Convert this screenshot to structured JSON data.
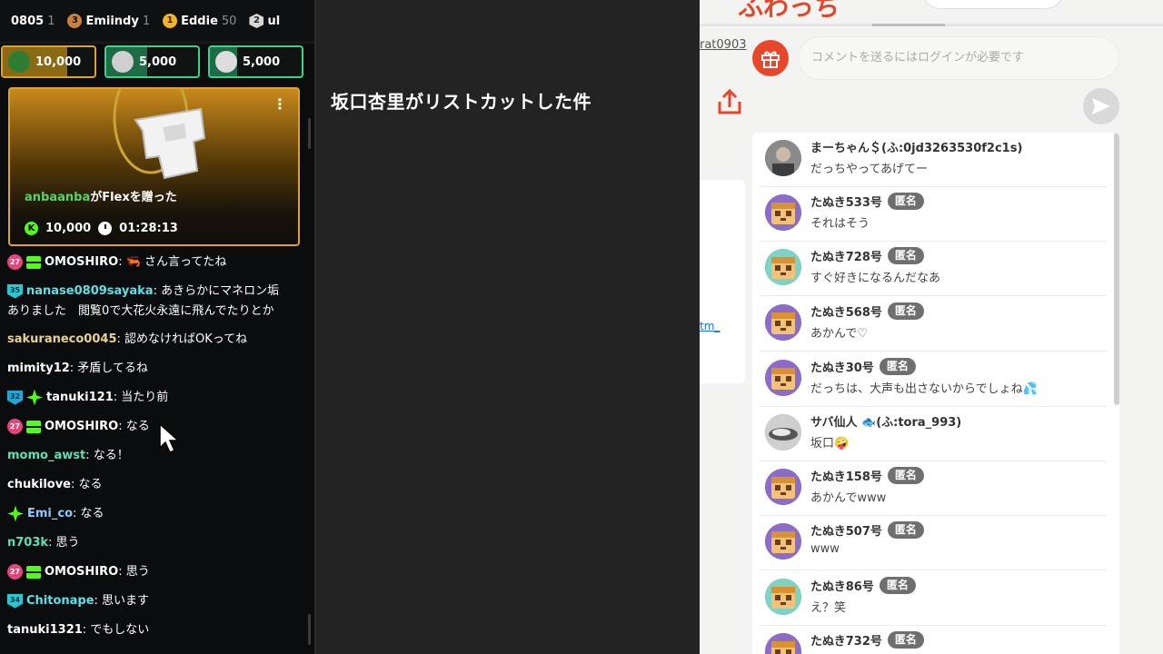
{
  "left_chat": {
    "leaderboard": [
      {
        "name": "0805",
        "count": "1",
        "medal": "none"
      },
      {
        "rank": "3",
        "name": "Emiindy",
        "count": "1",
        "medal": "bronze"
      },
      {
        "rank": "1",
        "name": "Eddie",
        "count": "50",
        "medal": "gold"
      },
      {
        "rank": "2",
        "name": "ul",
        "count": "",
        "medal": "silver"
      }
    ],
    "gift_pills": [
      {
        "amount": "10,000",
        "fill": 0.7,
        "border": "#e0a32a",
        "fill_color": "#8a6a14",
        "avatar": "#2e7d32"
      },
      {
        "amount": "5,000",
        "fill": 0.45,
        "border": "#3ad48a",
        "fill_color": "#1f6b45",
        "avatar": "#cfcfcf"
      },
      {
        "amount": "5,000",
        "fill": 0.3,
        "border": "#3ad48a",
        "fill_color": "#1f6b45",
        "avatar": "#dcdcdc"
      }
    ],
    "gift_card": {
      "user": "anbaanba",
      "text": "がFlexを贈った",
      "amount": "10,000",
      "time": "01:28:13"
    },
    "messages": [
      {
        "badges": [
          "sub27",
          "gift"
        ],
        "name": "OMOSHIRO",
        "color": "#ffffff",
        "text": ": 🦐 さん言ってたね"
      },
      {
        "badges": [
          "sub35"
        ],
        "name": "nanase0809sayaka",
        "color": "#5ce0e8",
        "text": ": あきらかにマネロン垢",
        "text2": "ありました　閲覧0で大花火永遠に飛んでたりとか"
      },
      {
        "badges": [],
        "name": "sakuraneco0045",
        "color": "#e9d28a",
        "text": ": 認めなければOKってね"
      },
      {
        "badges": [],
        "name": "mimity12",
        "color": "#ffffff",
        "text": ": 矛盾してるね"
      },
      {
        "badges": [
          "sub32",
          "star"
        ],
        "name": "tanuki121",
        "color": "#ffffff",
        "text": ": 当たり前"
      },
      {
        "badges": [
          "sub27",
          "gift"
        ],
        "name": "OMOSHIRO",
        "color": "#ffffff",
        "text": ": なる"
      },
      {
        "badges": [],
        "name": "momo_awst",
        "color": "#5ce0b5",
        "text": ": なる！"
      },
      {
        "badges": [],
        "name": "chukilove",
        "color": "#ffffff",
        "text": ": なる"
      },
      {
        "badges": [
          "star"
        ],
        "name": "Emi_co",
        "color": "#8fc7ff",
        "text": ": なる"
      },
      {
        "badges": [],
        "name": "n703k",
        "color": "#5ce0b5",
        "text": ": 思う"
      },
      {
        "badges": [
          "sub27",
          "gift"
        ],
        "name": "OMOSHIRO",
        "color": "#ffffff",
        "text": ": 思う"
      },
      {
        "badges": [
          "sub34"
        ],
        "name": "Chitonape",
        "color": "#5ce0e8",
        "text": ": 思います"
      },
      {
        "badges": [],
        "name": "tanuki1321",
        "color": "#ffffff",
        "text": ": でもしない"
      }
    ]
  },
  "center": {
    "title": "坂口杏里がリストカットした件"
  },
  "right_page": {
    "logo_text": "ふわっち",
    "user_link": "rat0903",
    "comment_placeholder": "コメントを送るにはログインが必要です",
    "side_link": "tm_",
    "comments": [
      {
        "name": "まーちゃん＄(ふ:0jd3263530f2c1s)",
        "tag": "",
        "text": "だっちやってあげてー",
        "avatar": "photo"
      },
      {
        "name": "たぬき533号",
        "tag": "匿名",
        "text": "それはそう",
        "avatar": "tanuki"
      },
      {
        "name": "たぬき728号",
        "tag": "匿名",
        "text": "すぐ好きになるんだなあ",
        "avatar": "tanuki2"
      },
      {
        "name": "たぬき568号",
        "tag": "匿名",
        "text": "あかんで♡",
        "avatar": "tanuki"
      },
      {
        "name": "たぬき30号",
        "tag": "匿名",
        "text": "だっちは、大声も出さないからでしょね💦",
        "avatar": "tanuki"
      },
      {
        "name": "サバ仙人 🐟(ふ:tora_993)",
        "tag": "",
        "text": "坂口🤪",
        "avatar": "photo2"
      },
      {
        "name": "たぬき158号",
        "tag": "匿名",
        "text": "あかんでwww",
        "avatar": "tanuki"
      },
      {
        "name": "たぬき507号",
        "tag": "匿名",
        "text": "www",
        "avatar": "tanuki"
      },
      {
        "name": "たぬき86号",
        "tag": "匿名",
        "text": "え？笑",
        "avatar": "tanuki2"
      },
      {
        "name": "たぬき732号",
        "tag": "匿名",
        "text": "",
        "avatar": "tanuki"
      }
    ]
  }
}
